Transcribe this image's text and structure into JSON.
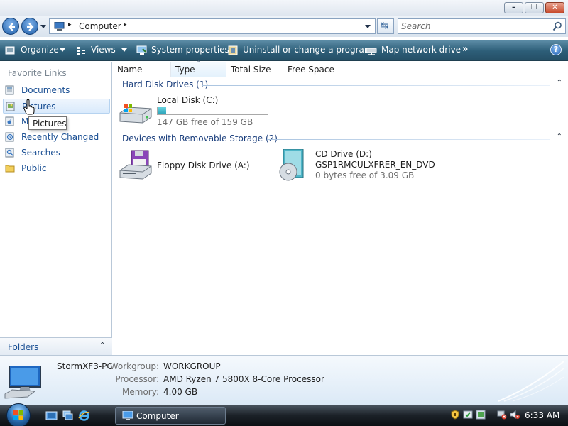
{
  "window": {
    "minimize_glyph": "–",
    "maximize_glyph": "❐",
    "close_glyph": "✕"
  },
  "address": {
    "path_segment": "Computer",
    "separator": "▸",
    "refresh_glyph": "↹",
    "search_placeholder": "Search"
  },
  "toolbar": {
    "organize": "Organize",
    "views": "Views",
    "system_properties": "System properties",
    "uninstall": "Uninstall or change a program",
    "map_drive": "Map network drive",
    "more": "»",
    "help": "?"
  },
  "nav": {
    "title": "Favorite Links",
    "items": [
      {
        "label": "Documents"
      },
      {
        "label": "Pictures"
      },
      {
        "label": "Music"
      },
      {
        "label": "Recently Changed"
      },
      {
        "label": "Searches"
      },
      {
        "label": "Public"
      }
    ],
    "folders_label": "Folders",
    "folders_chevron": "⌃"
  },
  "tooltip": "Pictures",
  "columns": [
    "Name",
    "Type",
    "Total Size",
    "Free Space"
  ],
  "sort_glyph": "⌃",
  "groups": {
    "hard_disk": {
      "label": "Hard Disk Drives (1)",
      "chevron": "⌃",
      "drives": [
        {
          "name": "Local Disk (C:)",
          "free_text": "147 GB free of 159 GB",
          "used_fraction": 0.075
        }
      ]
    },
    "removable": {
      "label": "Devices with Removable Storage (2)",
      "chevron": "⌃",
      "floppy": {
        "name": "Floppy Disk Drive (A:)"
      },
      "cd": {
        "name": "CD Drive (D:)",
        "volume": "GSP1RMCULXFRER_EN_DVD",
        "free_text": "0 bytes free of 3.09 GB"
      }
    }
  },
  "details": {
    "computer_name": "StormXF3-PC",
    "workgroup_label": "Workgroup:",
    "workgroup": "WORKGROUP",
    "processor_label": "Processor:",
    "processor": "AMD Ryzen 7 5800X 8-Core Processor",
    "memory_label": "Memory:",
    "memory": "4.00 GB"
  },
  "taskbar": {
    "task_label": "Computer",
    "clock": "6:33 AM"
  }
}
